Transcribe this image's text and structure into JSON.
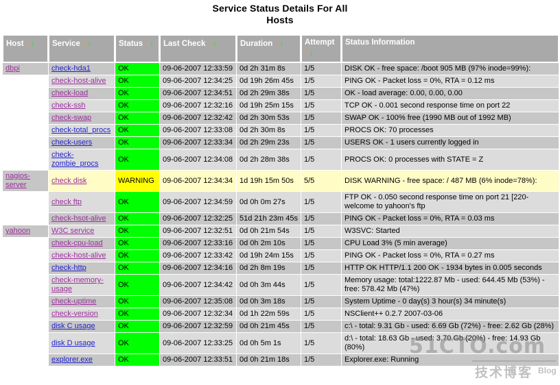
{
  "page": {
    "title_line1": "Service Status Details For All",
    "title_line2": "Hosts"
  },
  "watermark": {
    "main": "51CTO.com",
    "cn": "技术博客",
    "blog": "Blog"
  },
  "table": {
    "columns": [
      {
        "label": "Host",
        "sort_up": "↑",
        "sort_down": "↓"
      },
      {
        "label": "Service",
        "sort_up": "↑",
        "sort_down": "↓"
      },
      {
        "label": "Status",
        "sort_up": "↑",
        "sort_down": "↓"
      },
      {
        "label": "Last Check",
        "sort_up": "↑",
        "sort_down": "↓"
      },
      {
        "label": "Duration",
        "sort_up": "↑",
        "sort_down": "↓"
      },
      {
        "label": "Attempt",
        "sort_up": "↑",
        "sort_down": "↓"
      },
      {
        "label": "Status Information",
        "sort_up": "",
        "sort_down": ""
      }
    ],
    "rows": [
      {
        "host": "dbpi",
        "service": "check-hda1",
        "link_color": "blue",
        "status": "OK",
        "last_check": "09-06-2007 12:33:59",
        "duration": "0d 2h 31m 8s",
        "attempt": "1/5",
        "info": "DISK OK - free space: /boot 905 MB (97% inode=99%):",
        "shade": "dark"
      },
      {
        "host": "",
        "service": "check-host-alive",
        "link_color": "purple",
        "status": "OK",
        "last_check": "09-06-2007 12:34:25",
        "duration": "0d 19h 26m 45s",
        "attempt": "1/5",
        "info": "PING OK - Packet loss = 0%, RTA = 0.12 ms",
        "shade": "light"
      },
      {
        "host": "",
        "service": "check-load",
        "link_color": "purple",
        "status": "OK",
        "last_check": "09-06-2007 12:34:51",
        "duration": "0d 2h 29m 38s",
        "attempt": "1/5",
        "info": "OK - load average: 0.00, 0.00, 0.00",
        "shade": "dark"
      },
      {
        "host": "",
        "service": "check-ssh",
        "link_color": "purple",
        "status": "OK",
        "last_check": "09-06-2007 12:32:16",
        "duration": "0d 19h 25m 15s",
        "attempt": "1/5",
        "info": "TCP OK - 0.001 second response time on port 22",
        "shade": "light"
      },
      {
        "host": "",
        "service": "check-swap",
        "link_color": "purple",
        "status": "OK",
        "last_check": "09-06-2007 12:32:42",
        "duration": "0d 2h 30m 53s",
        "attempt": "1/5",
        "info": "SWAP OK - 100% free (1990 MB out of 1992 MB)",
        "shade": "dark"
      },
      {
        "host": "",
        "service": "check-total_procs",
        "link_color": "blue",
        "status": "OK",
        "last_check": "09-06-2007 12:33:08",
        "duration": "0d 2h 30m 8s",
        "attempt": "1/5",
        "info": "PROCS OK: 70 processes",
        "shade": "light"
      },
      {
        "host": "",
        "service": "check-users",
        "link_color": "blue",
        "status": "OK",
        "last_check": "09-06-2007 12:33:34",
        "duration": "0d 2h 29m 23s",
        "attempt": "1/5",
        "info": "USERS OK - 1 users currently logged in",
        "shade": "dark"
      },
      {
        "host": "",
        "service": "check-zombie_procs",
        "link_color": "blue",
        "status": "OK",
        "last_check": "09-06-2007 12:34:08",
        "duration": "0d 2h 28m 38s",
        "attempt": "1/5",
        "info": "PROCS OK: 0 processes with STATE = Z",
        "shade": "light"
      },
      {
        "host": "nagios-server",
        "service": "check disk",
        "link_color": "purple",
        "status": "WARNING",
        "last_check": "09-06-2007 12:34:34",
        "duration": "1d 19h 15m 50s",
        "attempt": "5/5",
        "info": "DISK WARNING - free space: / 487 MB (6% inode=78%):",
        "shade": "warn"
      },
      {
        "host": "",
        "service": "check ftp",
        "link_color": "purple",
        "status": "OK",
        "last_check": "09-06-2007 12:34:59",
        "duration": "0d 0h 0m 27s",
        "attempt": "1/5",
        "info": "FTP OK - 0.050 second response time on port 21 [220-welcome to yahoon's ftp",
        "shade": "light"
      },
      {
        "host": "",
        "service": "check-hsot-alive",
        "link_color": "purple",
        "status": "OK",
        "last_check": "09-06-2007 12:32:25",
        "duration": "51d 21h 23m 45s",
        "attempt": "1/5",
        "info": "PING OK - Packet loss = 0%, RTA = 0.03 ms",
        "shade": "dark"
      },
      {
        "host": "yahoon",
        "service": "W3C service",
        "link_color": "purple",
        "status": "OK",
        "last_check": "09-06-2007 12:32:51",
        "duration": "0d 0h 21m 54s",
        "attempt": "1/5",
        "info": "W3SVC: Started",
        "shade": "light"
      },
      {
        "host": "",
        "service": "check-cpu-load",
        "link_color": "purple",
        "status": "OK",
        "last_check": "09-06-2007 12:33:16",
        "duration": "0d 0h 2m 10s",
        "attempt": "1/5",
        "info": "CPU Load 3% (5 min average)",
        "shade": "dark"
      },
      {
        "host": "",
        "service": "check-host-alive",
        "link_color": "purple",
        "status": "OK",
        "last_check": "09-06-2007 12:33:42",
        "duration": "0d 19h 24m 15s",
        "attempt": "1/5",
        "info": "PING OK - Packet loss = 0%, RTA = 0.27 ms",
        "shade": "light"
      },
      {
        "host": "",
        "service": "check-http",
        "link_color": "blue",
        "status": "OK",
        "last_check": "09-06-2007 12:34:16",
        "duration": "0d 2h 8m 19s",
        "attempt": "1/5",
        "info": "HTTP OK HTTP/1.1 200 OK - 1934 bytes in 0.005 seconds",
        "shade": "dark"
      },
      {
        "host": "",
        "service": "check-memory-usage",
        "link_color": "purple",
        "status": "OK",
        "last_check": "09-06-2007 12:34:42",
        "duration": "0d 0h 3m 44s",
        "attempt": "1/5",
        "info": "Memory usage: total:1222.87 Mb - used: 644.45 Mb (53%) - free: 578.42 Mb (47%)",
        "shade": "light"
      },
      {
        "host": "",
        "service": "check-uptime",
        "link_color": "purple",
        "status": "OK",
        "last_check": "09-06-2007 12:35:08",
        "duration": "0d 0h 3m 18s",
        "attempt": "1/5",
        "info": "System Uptime - 0 day(s) 3 hour(s) 34 minute(s)",
        "shade": "dark"
      },
      {
        "host": "",
        "service": "check-version",
        "link_color": "purple",
        "status": "OK",
        "last_check": "09-06-2007 12:32:34",
        "duration": "0d 1h 22m 59s",
        "attempt": "1/5",
        "info": "NSClient++ 0.2.7 2007-03-06",
        "shade": "light"
      },
      {
        "host": "",
        "service": "disk C usage",
        "link_color": "blue",
        "status": "OK",
        "last_check": "09-06-2007 12:32:59",
        "duration": "0d 0h 21m 45s",
        "attempt": "1/5",
        "info": "c:\\ - total: 9.31 Gb - used: 6.69 Gb (72%) - free: 2.62 Gb (28%)",
        "shade": "dark"
      },
      {
        "host": "",
        "service": "disk D usage",
        "link_color": "blue",
        "status": "OK",
        "last_check": "09-06-2007 12:33:25",
        "duration": "0d 0h 5m 1s",
        "attempt": "1/5",
        "info": "d:\\ - total: 18.63 Gb - used: 3.70 Gb (20%) - free: 14.93 Gb (80%)",
        "shade": "light"
      },
      {
        "host": "",
        "service": "explorer.exe",
        "link_color": "blue",
        "status": "OK",
        "last_check": "09-06-2007 12:33:51",
        "duration": "0d 0h 21m 18s",
        "attempt": "1/5",
        "info": "Explorer.exe: Running",
        "shade": "dark"
      }
    ]
  }
}
